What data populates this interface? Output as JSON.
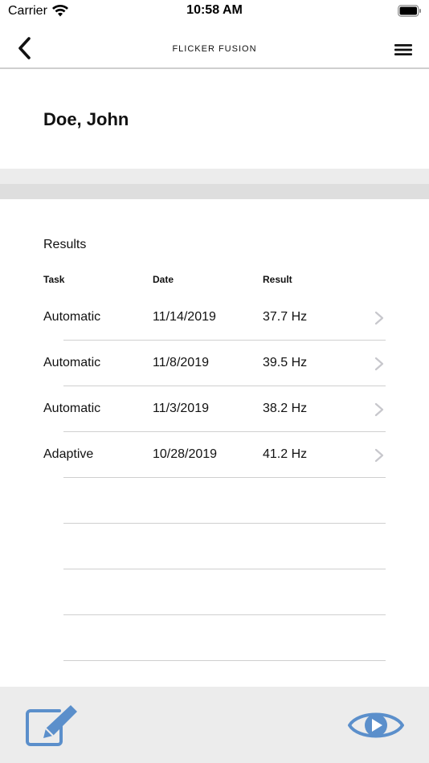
{
  "status_bar": {
    "carrier": "Carrier",
    "time": "10:58 AM",
    "wifi_icon": "wifi-icon",
    "battery_icon": "battery-icon"
  },
  "nav": {
    "title": "FLICKER FUSION",
    "back_icon": "chevron-left-icon",
    "menu_icon": "hamburger-menu-icon"
  },
  "patient": {
    "name": "Doe, John"
  },
  "results": {
    "title": "Results",
    "headers": {
      "task": "Task",
      "date": "Date",
      "result": "Result"
    },
    "rows": [
      {
        "task": "Automatic",
        "date": "11/14/2019",
        "result": "37.7 Hz"
      },
      {
        "task": "Automatic",
        "date": "11/8/2019",
        "result": "39.5 Hz"
      },
      {
        "task": "Automatic",
        "date": "11/3/2019",
        "result": "38.2 Hz"
      },
      {
        "task": "Adaptive",
        "date": "10/28/2019",
        "result": "41.2 Hz"
      }
    ]
  },
  "toolbar": {
    "edit_icon": "edit-icon",
    "view_icon": "eye-icon"
  },
  "colors": {
    "accent": "#5b8fcb",
    "band_light": "#ececec",
    "band_dark": "#dedede",
    "divider": "#cfcfcf",
    "chevron": "#c7c7cc"
  }
}
